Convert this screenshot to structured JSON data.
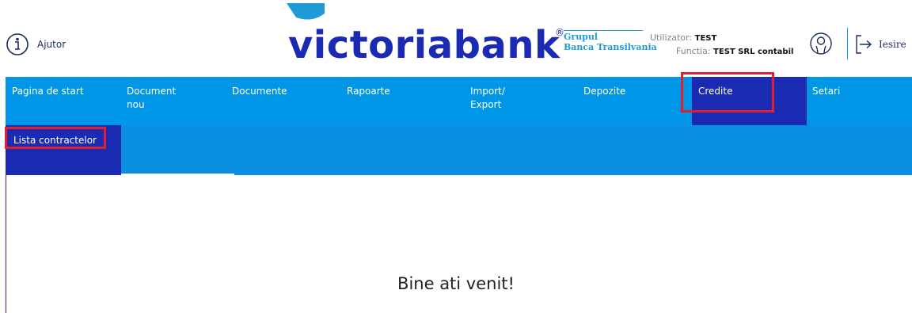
{
  "header": {
    "help_label": "Ajutor",
    "logo_text": "victoriabank",
    "logo_registered": "®",
    "group_line1": "Grupul",
    "group_line2": "Banca Transilvania",
    "user_label": "Utilizator:",
    "user_value": "TEST",
    "role_label": "Functia:",
    "role_value": "TEST SRL contabil",
    "logout_label": "Iesire"
  },
  "nav": {
    "items": [
      {
        "label": "Pagina de start"
      },
      {
        "label": "Document\nnou"
      },
      {
        "label": "Documente"
      },
      {
        "label": "Rapoarte"
      },
      {
        "label": "Import/\nExport"
      },
      {
        "label": "Depozite"
      },
      {
        "label": "Credite"
      },
      {
        "label": "Setari"
      }
    ]
  },
  "subnav": {
    "items": [
      {
        "label": "Lista contractelor"
      }
    ]
  },
  "main": {
    "welcome": "Bine ati venit!"
  },
  "colors": {
    "nav_bg": "#0096e8",
    "active_bg": "#1a2ab3",
    "highlight": "#e0202c",
    "brand_blue": "#1e9ad6"
  }
}
